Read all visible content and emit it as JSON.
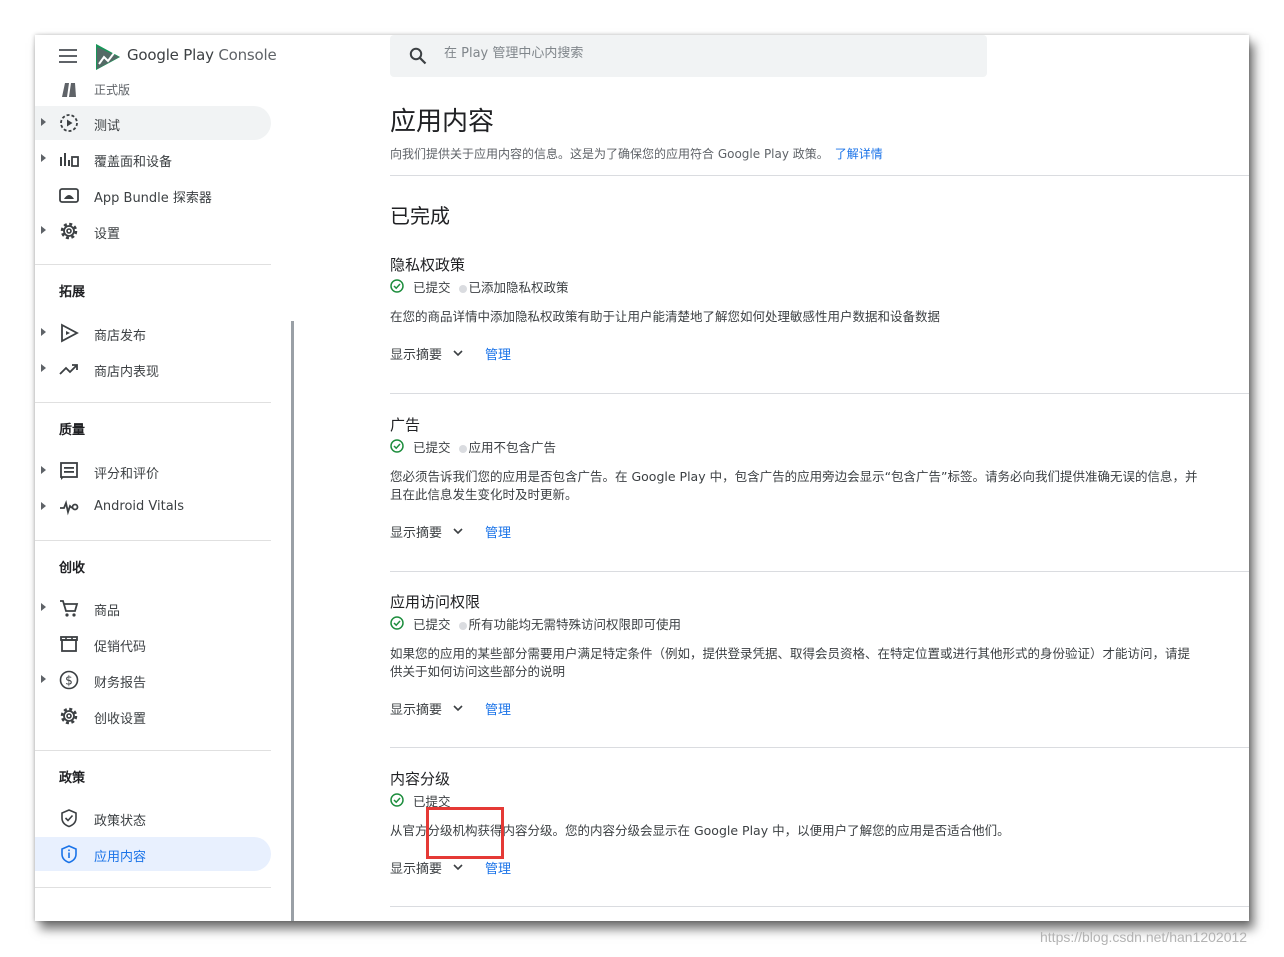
{
  "app": {
    "logo_google": "Google Play",
    "logo_console": "Console"
  },
  "search": {
    "placeholder": "在 Play 管理中心内搜索"
  },
  "sidebar": {
    "partial_item": "正式版",
    "items_top": [
      {
        "label": "测试",
        "icon": "play-circle-icon"
      },
      {
        "label": "覆盖面和设备",
        "icon": "bar-chart-icon"
      },
      {
        "label": "App Bundle 探索器",
        "icon": "android-bundle-icon"
      },
      {
        "label": "设置",
        "icon": "gear-icon"
      }
    ],
    "sections": [
      {
        "title": "拓展",
        "items": [
          {
            "label": "商店发布",
            "icon": "store-play-icon"
          },
          {
            "label": "商店内表现",
            "icon": "trending-up-icon"
          }
        ]
      },
      {
        "title": "质量",
        "items": [
          {
            "label": "评分和评价",
            "icon": "review-icon"
          },
          {
            "label": "Android Vitals",
            "icon": "vitals-icon"
          }
        ]
      },
      {
        "title": "创收",
        "items": [
          {
            "label": "商品",
            "icon": "cart-icon"
          },
          {
            "label": "促销代码",
            "icon": "store-icon"
          },
          {
            "label": "财务报告",
            "icon": "dollar-icon"
          },
          {
            "label": "创收设置",
            "icon": "gear-icon"
          }
        ]
      },
      {
        "title": "政策",
        "items": [
          {
            "label": "政策状态",
            "icon": "shield-check-icon"
          },
          {
            "label": "应用内容",
            "icon": "shield-info-icon"
          }
        ]
      }
    ]
  },
  "main": {
    "title": "应用内容",
    "description": "向我们提供关于应用内容的信息。这是为了确保您的应用符合 Google Play 政策。",
    "learn_more": "了解详情",
    "section_heading": "已完成",
    "policies": [
      {
        "title": "隐私权政策",
        "status": "已提交",
        "detail": "已添加隐私权政策",
        "description": "在您的商品详情中添加隐私权政策有助于让用户能清楚地了解您如何处理敏感性用户数据和设备数据",
        "summary_label": "显示摘要",
        "manage_label": "管理"
      },
      {
        "title": "广告",
        "status": "已提交",
        "detail": "应用不包含广告",
        "description": "您必须告诉我们您的应用是否包含广告。在 Google Play 中，包含广告的应用旁边会显示“包含广告”标签。请务必向我们提供准确无误的信息，并且在此信息发生变化时及时更新。",
        "summary_label": "显示摘要",
        "manage_label": "管理"
      },
      {
        "title": "应用访问权限",
        "status": "已提交",
        "detail": "所有功能均无需特殊访问权限即可使用",
        "description": "如果您的应用的某些部分需要用户满足特定条件（例如，提供登录凭据、取得会员资格、在特定位置或进行其他形式的身份验证）才能访问，请提供关于如何访问这些部分的说明",
        "summary_label": "显示摘要",
        "manage_label": "管理"
      },
      {
        "title": "内容分级",
        "status": "已提交",
        "detail": "",
        "description": "从官方分级机构获得内容分级。您的内容分级会显示在 Google Play 中，以便用户了解您的应用是否适合他们。",
        "summary_label": "显示摘要",
        "manage_label": "管理"
      }
    ]
  },
  "colors": {
    "accent": "#1a73e8",
    "success": "#1e8e3e",
    "highlight": "#e53935"
  },
  "watermark": "https://blog.csdn.net/han1202012"
}
